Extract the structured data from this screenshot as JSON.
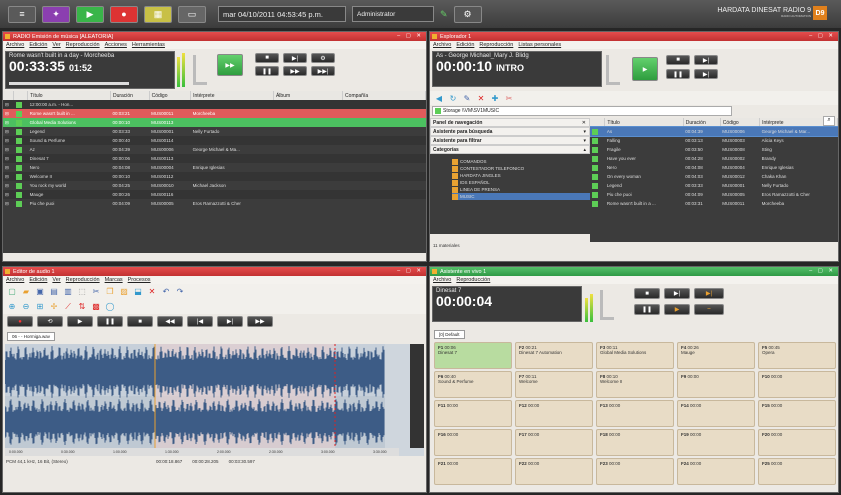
{
  "topbar": {
    "datetime": "mar 04/10/2011 04:53:45 p.m.",
    "user": "Administrator",
    "brand": "HARDATA DINESAT RADIO 9",
    "brand_sub": "RADIO AUTOMATION",
    "logo": "D9"
  },
  "radio": {
    "title": "RADIO Emisión de música [ALEATORIA]",
    "menu": [
      "Archivo",
      "Edición",
      "Ver",
      "Reproducción",
      "Acciones",
      "Herramientas"
    ],
    "song": "Rome wasn't built in a day - Morcheeba",
    "time": "00:33:35",
    "remaining": "01:52",
    "columns": [
      "Título",
      "Duración",
      "Código",
      "Intérprete",
      "Álbum",
      "Compañía"
    ],
    "rows": [
      {
        "title": "12:00:00 a.m. - Hon...",
        "dur": "",
        "code": "",
        "artist": "",
        "style": "dark2"
      },
      {
        "title": "Rome wasn't built in ...",
        "dur": "00:03:21",
        "code": "MUS00011",
        "artist": "Morcheeba",
        "style": "sel"
      },
      {
        "title": "Global Media Solutions",
        "dur": "00:00:10",
        "code": "MUS00113",
        "artist": "",
        "style": "play"
      },
      {
        "title": "Legend",
        "dur": "00:03:33",
        "code": "MUS00001",
        "artist": "Nelly Furtado",
        "style": "dark"
      },
      {
        "title": "Sound & Perfume",
        "dur": "00:00:40",
        "code": "MUS00114",
        "artist": "",
        "style": "dark2"
      },
      {
        "title": "Az",
        "dur": "00:04:39",
        "code": "MUS00006",
        "artist": "George Michael & Ma...",
        "style": "dark"
      },
      {
        "title": "Dinesat 7",
        "dur": "00:00:06",
        "code": "MUS00113",
        "artist": "",
        "style": "dark2"
      },
      {
        "title": "Nero",
        "dur": "00:04:08",
        "code": "MUS00004",
        "artist": "Enrique Iglesias",
        "style": "dark"
      },
      {
        "title": "Welcome II",
        "dur": "00:00:10",
        "code": "MUS00112",
        "artist": "",
        "style": "dark2"
      },
      {
        "title": "You rock my world",
        "dur": "00:04:25",
        "code": "MUS00010",
        "artist": "Michael Jackson",
        "style": "dark"
      },
      {
        "title": "Mauge",
        "dur": "00:00:26",
        "code": "MUS00116",
        "artist": "",
        "style": "dark2"
      },
      {
        "title": "Piu che puoi",
        "dur": "00:04:09",
        "code": "MUS00005",
        "artist": "Eros Ramazzotti & Cher",
        "style": "dark"
      }
    ]
  },
  "explorer": {
    "title": "Explorador 1",
    "menu": [
      "Archivo",
      "Edición",
      "Reproducción",
      "Listas personales"
    ],
    "song": "As - George Michael_Mary J. Blidg",
    "time": "00:00:10",
    "status_label": "INTRO",
    "path": "Storage \\\\VM\\SV1MUSIC",
    "nav": [
      "Panel de navegación",
      "Asistente para búsqueda",
      "Asistente para filtrar",
      "Categorías"
    ],
    "categories": [
      "COMANDOS",
      "CONTESTADOR TELEFONICO",
      "HARDATA JINGLES",
      "IDS ESPAÑOL",
      "LINEA DE PRENSA",
      "MUSIC"
    ],
    "columns": [
      "Título",
      "Duración",
      "Código",
      "Intérprete"
    ],
    "rows": [
      {
        "title": "As",
        "dur": "00:04:39",
        "code": "MUS00006",
        "artist": "George Michael & Mar...",
        "sel": true
      },
      {
        "title": "Falling",
        "dur": "00:03:13",
        "code": "MUS00003",
        "artist": "Alicia Keys"
      },
      {
        "title": "Fragile",
        "dur": "00:03:50",
        "code": "MUS00008",
        "artist": "Sting"
      },
      {
        "title": "Have you ever",
        "dur": "00:04:28",
        "code": "MUS00002",
        "artist": "Brandy"
      },
      {
        "title": "Nero",
        "dur": "00:04:08",
        "code": "MUS00004",
        "artist": "Enrique Iglesias"
      },
      {
        "title": "On every woman",
        "dur": "00:04:03",
        "code": "MUS00012",
        "artist": "Chaka Khan"
      },
      {
        "title": "Legend",
        "dur": "00:03:33",
        "code": "MUS00001",
        "artist": "Nelly Furtado"
      },
      {
        "title": "Piu che puoi",
        "dur": "00:04:09",
        "code": "MUS00005",
        "artist": "Eros Ramazzotti & Cher"
      },
      {
        "title": "Rome wasn't built in a ...",
        "dur": "00:03:31",
        "code": "MUS00011",
        "artist": "Morcheeba"
      }
    ],
    "footer": "11 materiales"
  },
  "editor": {
    "title": "Editor de audio 1",
    "menu": [
      "Archivo",
      "Edición",
      "Ver",
      "Reproducción",
      "Marcas",
      "Procesos"
    ],
    "tab": "06 - - Hormiga.wav",
    "status_fmt": "PCM 44,1 kHz, 16 Bit, (Stereo)",
    "t1": "00:00:18.867",
    "t2": "00:00:28.205",
    "t3": "00:03:30.597",
    "ticks": [
      "0:00.000",
      "0:30.000",
      "1:00.000",
      "1:30.000",
      "2:00.000",
      "2:30.000",
      "3:00.000",
      "3:30.000"
    ]
  },
  "live": {
    "title": "Asistente en vivo 1",
    "menu": [
      "Archivo",
      "Reproducción"
    ],
    "song": "Dinesat 7",
    "time": "00:00:04",
    "tab": "[0] Default",
    "keys": [
      {
        "k": "F1",
        "t": "00:06",
        "n": "Dinesat 7"
      },
      {
        "k": "F2",
        "t": "00:21",
        "n": "Dinesat 7 Automation"
      },
      {
        "k": "F3",
        "t": "00:11",
        "n": "Global Media Solutions"
      },
      {
        "k": "F4",
        "t": "00:26",
        "n": "Mauge"
      },
      {
        "k": "F5",
        "t": "00:45",
        "n": "Opera"
      },
      {
        "k": "F6",
        "t": "00:40",
        "n": "Sound & Perfume"
      },
      {
        "k": "F7",
        "t": "00:11",
        "n": "Welcome"
      },
      {
        "k": "F8",
        "t": "00:10",
        "n": "Welcome II"
      },
      {
        "k": "F9",
        "t": "00:00",
        "n": ""
      },
      {
        "k": "F10",
        "t": "00:00",
        "n": ""
      },
      {
        "k": "F11",
        "t": "00:00",
        "n": ""
      },
      {
        "k": "F12",
        "t": "00:00",
        "n": ""
      },
      {
        "k": "F13",
        "t": "00:00",
        "n": ""
      },
      {
        "k": "F14",
        "t": "00:00",
        "n": ""
      },
      {
        "k": "F15",
        "t": "00:00",
        "n": ""
      },
      {
        "k": "F16",
        "t": "00:00",
        "n": ""
      },
      {
        "k": "F17",
        "t": "00:00",
        "n": ""
      },
      {
        "k": "F18",
        "t": "00:00",
        "n": ""
      },
      {
        "k": "F19",
        "t": "00:00",
        "n": ""
      },
      {
        "k": "F20",
        "t": "00:00",
        "n": ""
      },
      {
        "k": "F21",
        "t": "00:00",
        "n": ""
      },
      {
        "k": "F22",
        "t": "00:00",
        "n": ""
      },
      {
        "k": "F23",
        "t": "00:00",
        "n": ""
      },
      {
        "k": "F24",
        "t": "00:00",
        "n": ""
      },
      {
        "k": "F25",
        "t": "00:00",
        "n": ""
      }
    ]
  }
}
